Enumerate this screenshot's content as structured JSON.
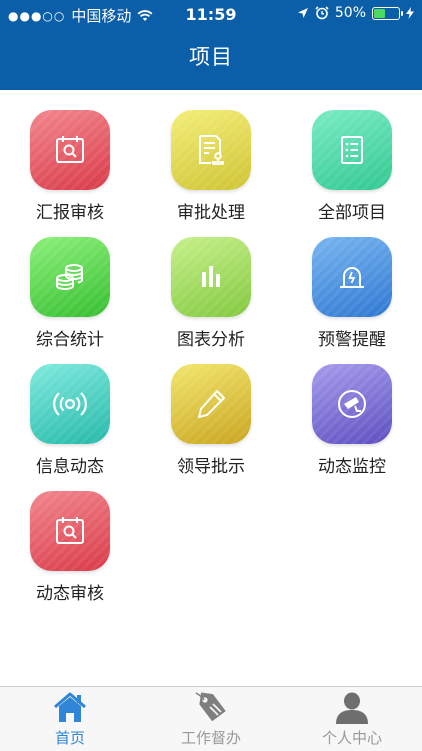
{
  "status_bar": {
    "carrier": "中国移动",
    "time": "11:59",
    "battery_percent_text": "50%",
    "battery_level": 0.5
  },
  "header": {
    "title": "项目"
  },
  "grid": {
    "items": [
      {
        "label": "汇报审核",
        "icon": "calendar-search-icon",
        "color_top": "#f2868d",
        "color_bottom": "#d93a48"
      },
      {
        "label": "审批处理",
        "icon": "document-stamp-icon",
        "color_top": "#f3ee78",
        "color_bottom": "#cfc433"
      },
      {
        "label": "全部项目",
        "icon": "list-icon",
        "color_top": "#79ecc4",
        "color_bottom": "#31c891"
      },
      {
        "label": "综合统计",
        "icon": "coins-icon",
        "color_top": "#8cf07a",
        "color_bottom": "#35bf2f"
      },
      {
        "label": "图表分析",
        "icon": "bar-chart-icon",
        "color_top": "#c6f08a",
        "color_bottom": "#82c93e"
      },
      {
        "label": "预警提醒",
        "icon": "alarm-icon",
        "color_top": "#77b5f0",
        "color_bottom": "#2f78d2"
      },
      {
        "label": "信息动态",
        "icon": "broadcast-icon",
        "color_top": "#7feadf",
        "color_bottom": "#25b9a8"
      },
      {
        "label": "领导批示",
        "icon": "pencil-icon",
        "color_top": "#f2e66c",
        "color_bottom": "#c9a51f"
      },
      {
        "label": "动态监控",
        "icon": "camera-icon",
        "color_top": "#a59bec",
        "color_bottom": "#5d4fc0"
      },
      {
        "label": "动态审核",
        "icon": "calendar-search-icon",
        "color_top": "#f2868d",
        "color_bottom": "#d93a48"
      }
    ]
  },
  "tabs": [
    {
      "label": "首页",
      "icon": "home-icon",
      "active": true
    },
    {
      "label": "工作督办",
      "icon": "tag-icon",
      "active": false
    },
    {
      "label": "个人中心",
      "icon": "person-icon",
      "active": false
    }
  ],
  "colors": {
    "header_bg": "#0b5fa8",
    "tab_active": "#2f86d6",
    "tab_inactive": "#9a9a9a"
  }
}
